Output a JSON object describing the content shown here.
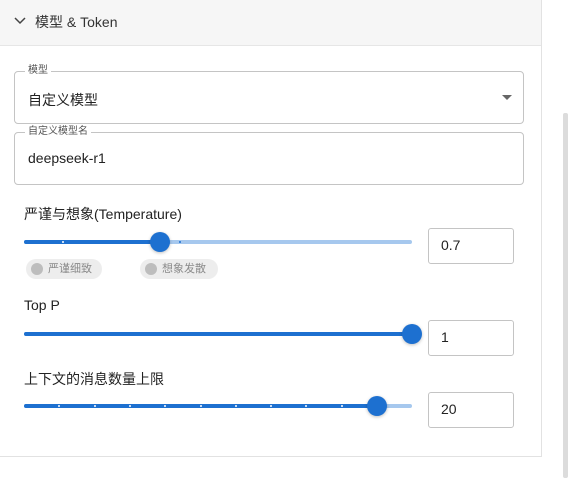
{
  "section": {
    "title": "模型 & Token"
  },
  "model_field": {
    "legend": "模型",
    "value": "自定义模型"
  },
  "custom_model_field": {
    "legend": "自定义模型名",
    "value": "deepseek-r1"
  },
  "temperature": {
    "label": "严谨与想象(Temperature)",
    "value": "0.7",
    "level": 0.35,
    "chip_left": "严谨细致",
    "chip_right": "想象发散"
  },
  "top_p": {
    "label": "Top P",
    "value": "1",
    "level": 1.0
  },
  "context_limit": {
    "label": "上下文的消息数量上限",
    "value": "20",
    "level": 0.91
  },
  "colors": {
    "accent": "#1d70d0",
    "track": "#a6c8ee"
  }
}
